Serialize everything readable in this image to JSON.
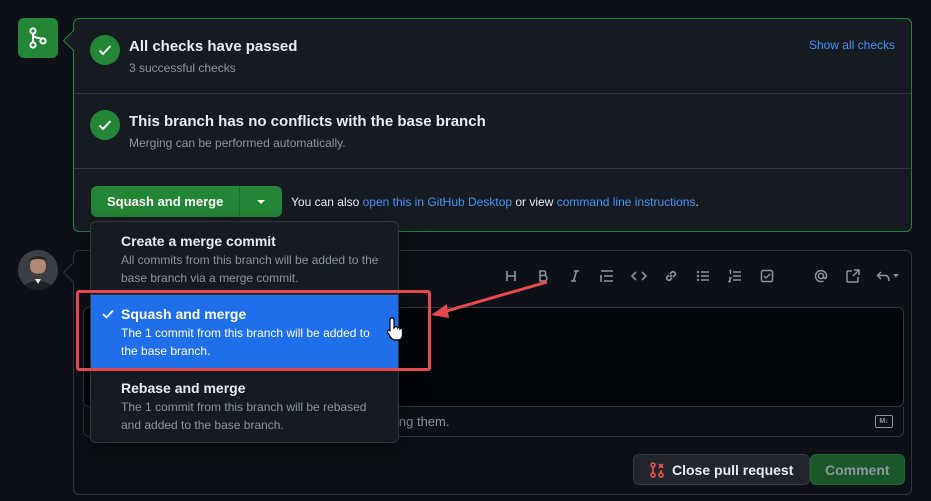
{
  "checks": {
    "title": "All checks have passed",
    "subtitle": "3 successful checks",
    "link": "Show all checks"
  },
  "conflicts": {
    "title": "This branch has no conflicts with the base branch",
    "subtitle": "Merging can be performed automatically."
  },
  "merge_button": {
    "label": "Squash and merge",
    "also_prefix": "You can also ",
    "desktop_link": "open this in GitHub Desktop",
    "middle": " or view ",
    "cli_link": "command line instructions",
    "suffix": "."
  },
  "dropdown": {
    "items": [
      {
        "title": "Create a merge commit",
        "desc": "All commits from this branch will be added to the base branch via a merge commit.",
        "selected": false
      },
      {
        "title": "Squash and merge",
        "desc": "The 1 commit from this branch will be added to the base branch.",
        "selected": true
      },
      {
        "title": "Rebase and merge",
        "desc": "The 1 commit from this branch will be rebased and added to the base branch.",
        "selected": false
      }
    ]
  },
  "comment": {
    "hint_fragment": "ing them.",
    "markdown_badge": "M↓",
    "close_label": "Close pull request",
    "comment_label": "Comment"
  },
  "toolbar_icons": [
    "heading-icon",
    "bold-icon",
    "italic-icon",
    "quote-icon",
    "code-icon",
    "link-icon",
    "unordered-list-icon",
    "ordered-list-icon",
    "task-list-icon",
    "mention-icon",
    "reference-icon",
    "reply-icon"
  ],
  "colors": {
    "green": "#238636",
    "blue": "#1f6feb",
    "link": "#4493f8",
    "annotation_red": "#e5484d"
  }
}
